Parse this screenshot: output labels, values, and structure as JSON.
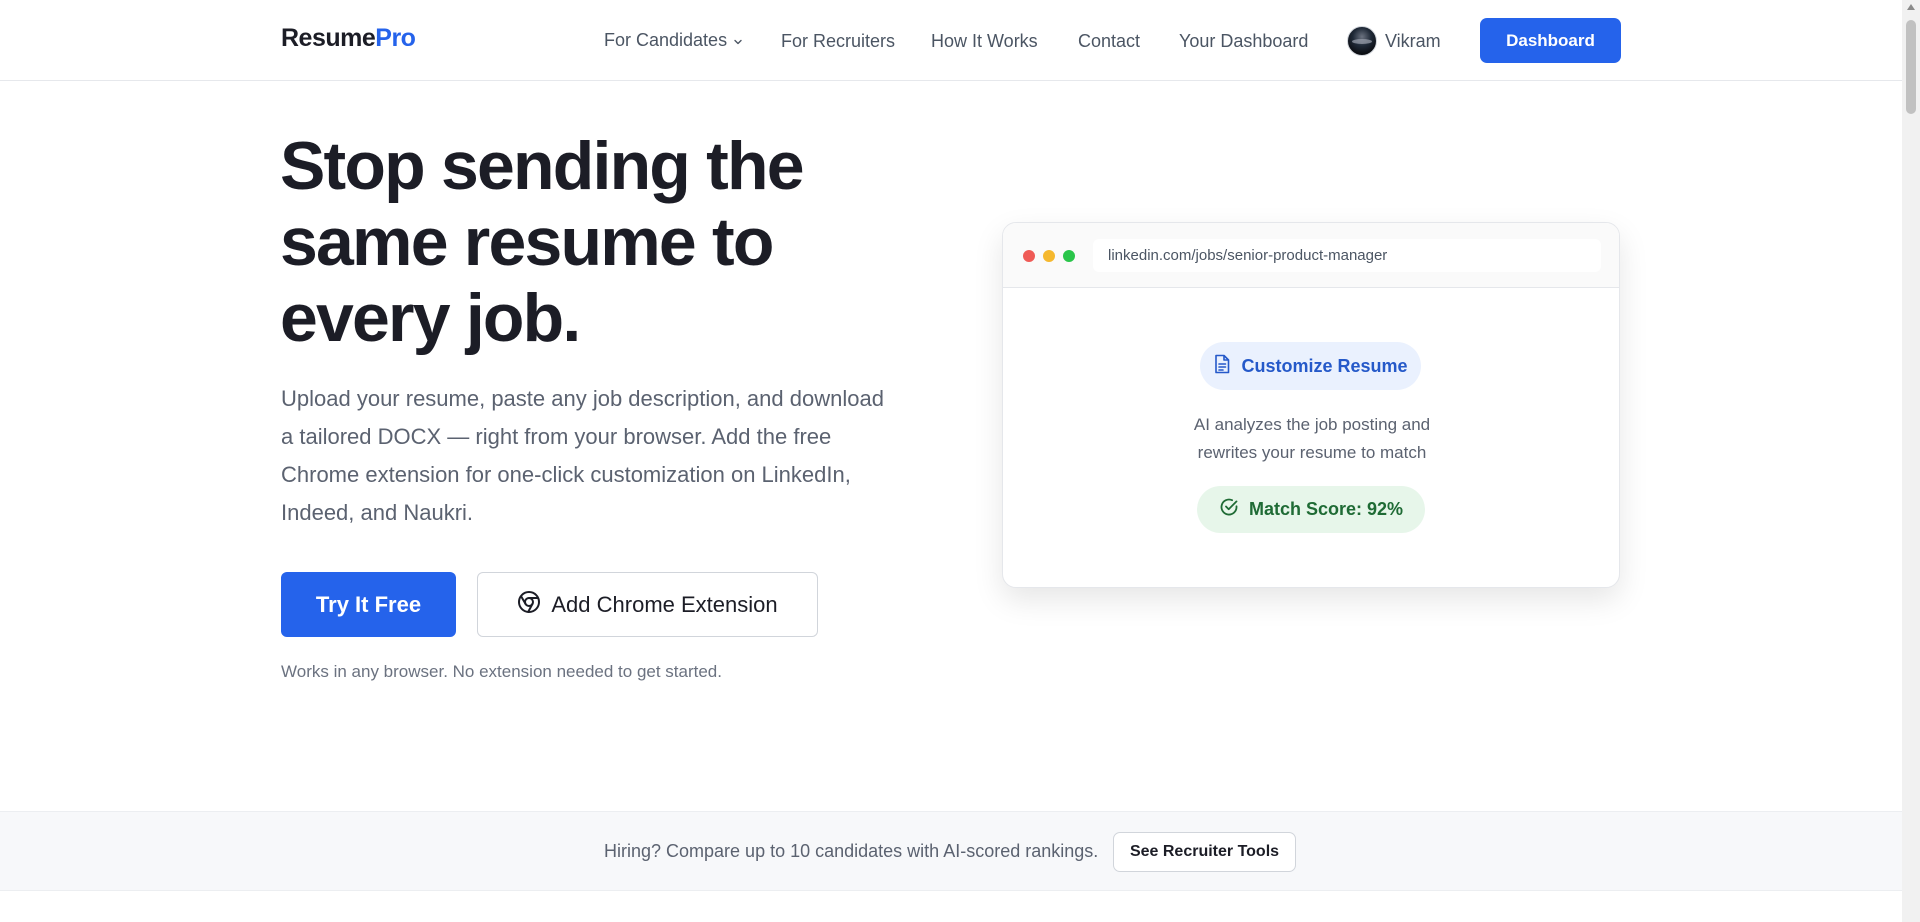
{
  "header": {
    "logo_main": "Resume",
    "logo_accent": "Pro",
    "nav": {
      "for_candidates": "For Candidates",
      "for_recruiters": "For Recruiters",
      "how_it_works": "How It Works",
      "contact": "Contact",
      "your_dashboard": "Your Dashboard"
    },
    "user_name": "Vikram",
    "dashboard_button": "Dashboard"
  },
  "hero": {
    "title": "Stop sending the same resume to every job.",
    "subtitle": "Upload your resume, paste any job description, and download a tailored DOCX — right from your browser. Add the free Chrome extension for one-click customization on LinkedIn, Indeed, and Naukri.",
    "primary_button": "Try It Free",
    "secondary_button": "Add Chrome Extension",
    "note": "Works in any browser. No extension needed to get started."
  },
  "mockup": {
    "url": "linkedin.com/jobs/senior-product-manager",
    "customize_label": "Customize Resume",
    "description_line1": "AI analyzes the job posting and",
    "description_line2": "rewrites your resume to match",
    "match_score": "Match Score: 92%"
  },
  "recruiter_strip": {
    "text": "Hiring? Compare up to 10 candidates with AI-scored rankings.",
    "button": "See Recruiter Tools"
  },
  "colors": {
    "brand": "#2563eb",
    "text_dark": "#1c1d26",
    "text_muted": "#5b6270",
    "success": "#1f6b35",
    "dot_red": "#ef5b56",
    "dot_yellow": "#f5b82e",
    "dot_green": "#2ac54a"
  },
  "icons": {
    "chevron": "chevron-down-icon",
    "chrome": "chrome-icon",
    "document": "document-icon",
    "check": "check-circle-icon"
  }
}
